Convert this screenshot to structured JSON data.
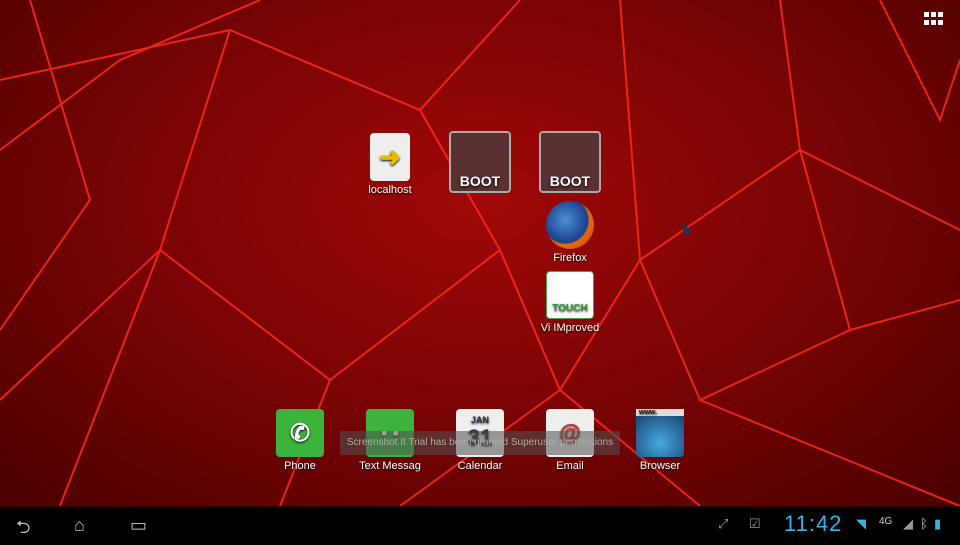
{
  "desktop": {
    "shortcuts": [
      {
        "label": "localhost",
        "icon": "localhost-icon"
      },
      {
        "label": "BOOT",
        "icon": "boot-ubuntu-icon"
      },
      {
        "label": "BOOT",
        "icon": "boot-android-icon"
      },
      {
        "label": "Firefox",
        "icon": "firefox-icon"
      },
      {
        "label": "Vi IMproved",
        "icon": "vim-touch-icon",
        "icon_text": "TOUCH"
      }
    ]
  },
  "dock": [
    {
      "label": "Phone",
      "icon": "phone-icon"
    },
    {
      "label": "Text Messag",
      "icon": "messaging-icon"
    },
    {
      "label": "Calendar",
      "icon": "calendar-icon",
      "month": "JAN",
      "day": "31"
    },
    {
      "label": "Email",
      "icon": "email-icon",
      "glyph": "@"
    },
    {
      "label": "Browser",
      "icon": "browser-icon",
      "url_text": "www."
    }
  ],
  "toast": "Screenshot It Trial has been granted Superuser permissions",
  "status": {
    "time": "11:42",
    "network": "4G",
    "accent": "#33b5e5"
  }
}
